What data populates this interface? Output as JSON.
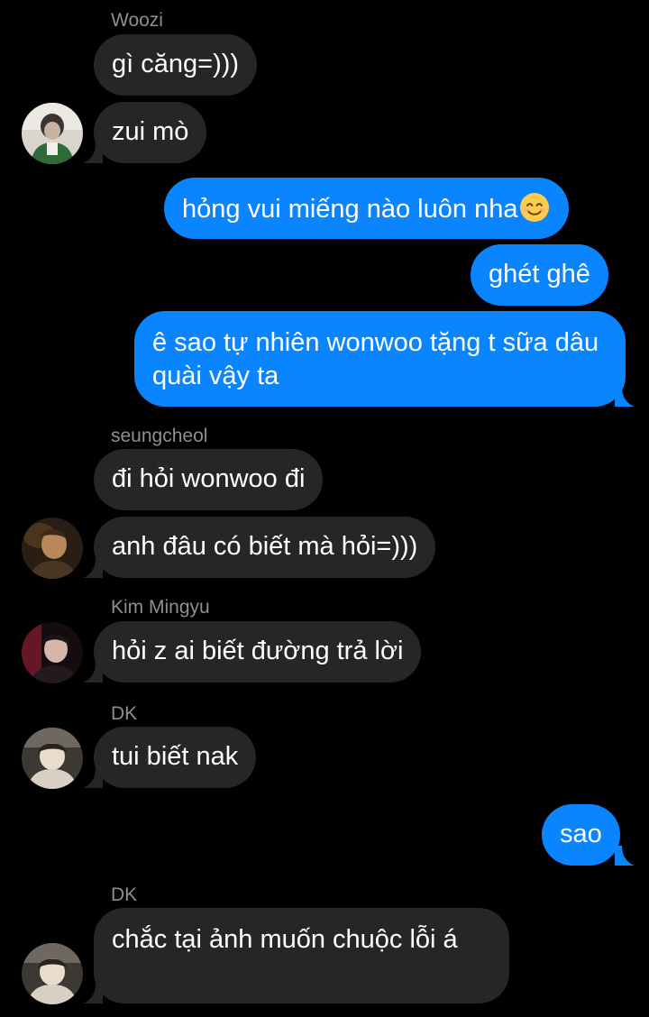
{
  "thread": {
    "groups": [
      {
        "sender": "Woozi",
        "messages": [
          "gì căng=)))",
          "zui mò"
        ]
      },
      {
        "sender": "me",
        "messages": [
          "hỏng vui miếng nào luôn nha",
          "ghét ghê",
          "ê sao tự nhiên wonwoo tặng t sữa dâu quài vậy ta"
        ],
        "emoji": "smiling-face-icon"
      },
      {
        "sender": "seungcheol",
        "messages": [
          "đi hỏi wonwoo đi",
          "anh đâu có biết mà hỏi=)))"
        ]
      },
      {
        "sender": "Kim Mingyu",
        "messages": [
          "hỏi z ai biết đường trả lời"
        ]
      },
      {
        "sender": "DK",
        "messages": [
          "tui biết nak"
        ]
      },
      {
        "sender": "me",
        "messages": [
          "sao"
        ]
      },
      {
        "sender": "DK",
        "messages": [
          "chắc tại ảnh muốn chuộc lỗi á"
        ]
      }
    ]
  },
  "colors": {
    "background": "#000000",
    "incoming_bubble": "#262629",
    "outgoing_bubble": "#0a84ff",
    "sender_name": "#8e8e93",
    "text": "#ffffff"
  }
}
